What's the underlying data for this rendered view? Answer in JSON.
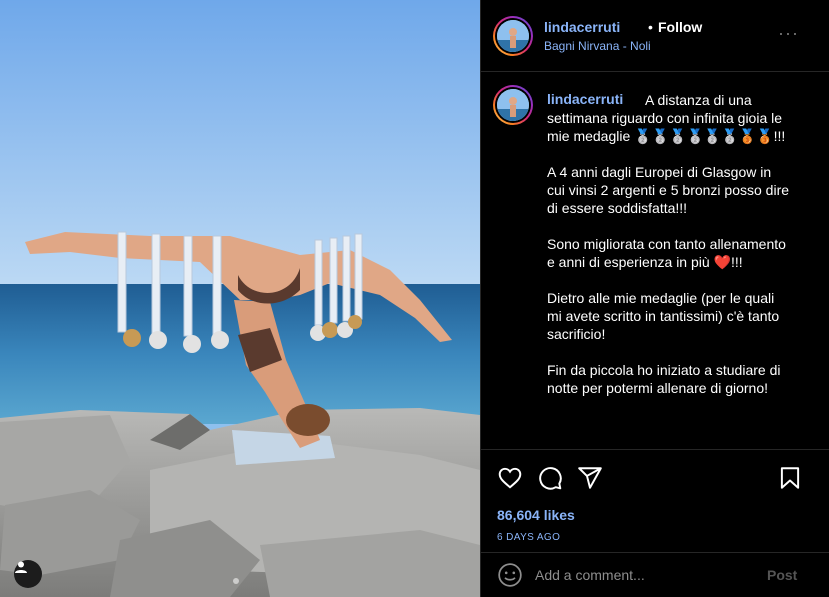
{
  "post": {
    "username": "lindacerruti",
    "separator": "•",
    "follow_label": "Follow",
    "location": "Bagni Nirvana - Noli",
    "more_label": "···"
  },
  "caption": {
    "username": "lindacerruti",
    "paragraphs": [
      "A distanza di una settimana riguardo con infinita gioia le mie medaglie 🥈🥈🥈🥈🥈🥈🥉🥉!!!",
      "A 4 anni dagli Europei di Glasgow in cui vinsi 2 argenti e 5 bronzi posso dire di essere soddisfatta!!!",
      "Sono migliorata con tanto allenamento e anni di esperienza in più ❤️!!!",
      "Dietro alle mie medaglie (per le quali mi avete scritto in tantissimi) c'è tanto sacrificio!",
      "Fin da piccola ho iniziato a studiare di notte per potermi allenare di giorno!"
    ]
  },
  "actions": {
    "like_icon": "heart-icon",
    "comment_icon": "comment-icon",
    "share_icon": "share-icon",
    "save_icon": "bookmark-icon"
  },
  "likes": "86,604 likes",
  "date": "6 DAYS AGO",
  "comment": {
    "placeholder": "Add a comment...",
    "post_label": "Post"
  },
  "colors": {
    "accent": "#8ab4f8",
    "background": "#000000",
    "divider": "#262626"
  }
}
